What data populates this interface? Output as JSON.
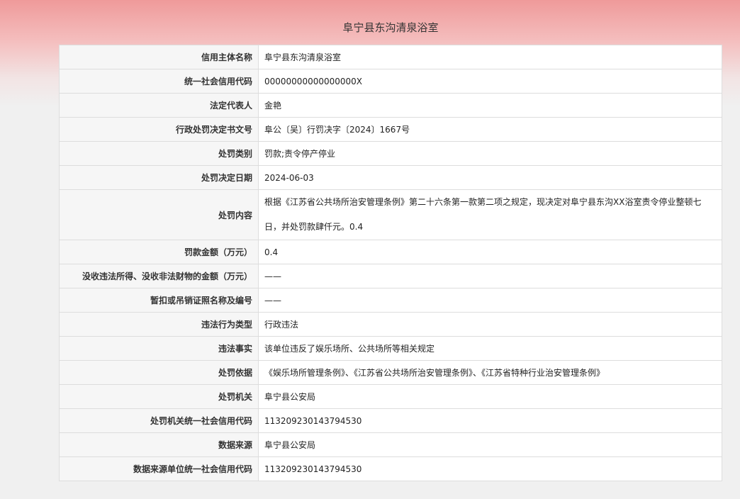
{
  "page": {
    "title": "阜宁县东沟清泉浴室"
  },
  "rows": [
    {
      "label": "信用主体名称",
      "value": "阜宁县东沟清泉浴室"
    },
    {
      "label": "统一社会信用代码",
      "value": "00000000000000000X"
    },
    {
      "label": "法定代表人",
      "value": "金艳"
    },
    {
      "label": "行政处罚决定书文号",
      "value": "阜公〔吴〕行罚决字〔2024〕1667号"
    },
    {
      "label": "处罚类别",
      "value": "罚款;责令停产停业"
    },
    {
      "label": "处罚决定日期",
      "value": "2024-06-03"
    },
    {
      "label": "处罚内容",
      "value": "根据《江苏省公共场所治安管理条例》第二十六条第一款第二项之规定，现决定对阜宁县东沟XX浴室责令停业整顿七日，并处罚款肆仟元。0.4"
    },
    {
      "label": "罚款金额（万元）",
      "value": "0.4"
    },
    {
      "label": "没收违法所得、没收非法财物的金额（万元）",
      "value": "——"
    },
    {
      "label": "暂扣或吊销证照名称及编号",
      "value": "——"
    },
    {
      "label": "违法行为类型",
      "value": "行政违法"
    },
    {
      "label": "违法事实",
      "value": "该单位违反了娱乐场所、公共场所等相关规定"
    },
    {
      "label": "处罚依据",
      "value": "《娱乐场所管理条例》、《江苏省公共场所治安管理条例》、《江苏省特种行业治安管理条例》"
    },
    {
      "label": "处罚机关",
      "value": "阜宁县公安局"
    },
    {
      "label": "处罚机关统一社会信用代码",
      "value": "113209230143794530"
    },
    {
      "label": "数据来源",
      "value": "阜宁县公安局"
    },
    {
      "label": "数据来源单位统一社会信用代码",
      "value": "113209230143794530"
    }
  ]
}
